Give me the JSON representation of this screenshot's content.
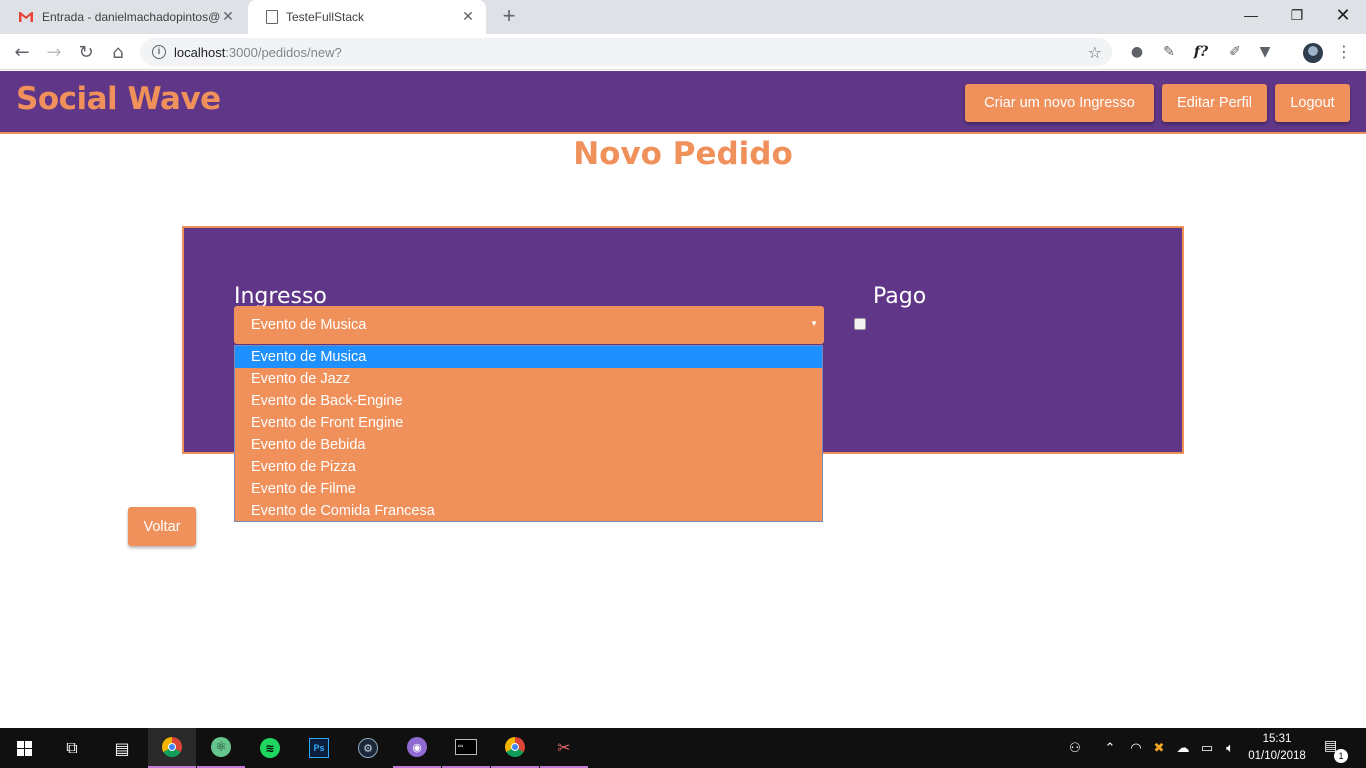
{
  "browser": {
    "tabs": [
      {
        "title": "Entrada - danielmachadopintos@",
        "icon": "gmail-icon",
        "active": false
      },
      {
        "title": "TesteFullStack",
        "icon": "page-icon",
        "active": true
      }
    ],
    "url_host": "localhost",
    "url_path": ":3000/pedidos/new?"
  },
  "navbar": {
    "brand": "Social Wave",
    "buttons": [
      {
        "label": "Criar um novo Ingresso"
      },
      {
        "label": "Editar Perfil"
      },
      {
        "label": "Logout"
      }
    ]
  },
  "page": {
    "title": "Novo Pedido",
    "form": {
      "ingresso_label": "Ingresso",
      "ingresso_selected": "Evento de Musica",
      "pago_label": "Pago",
      "pago_checked": false,
      "options": [
        "Evento de Musica",
        "Evento de Jazz",
        "Evento de Back-Engine",
        "Evento de Front Engine",
        "Evento de Bebida",
        "Evento de Pizza",
        "Evento de Filme",
        "Evento de Comida Francesa"
      ],
      "highlighted_option": "Evento de Musica"
    },
    "back_button": "Voltar"
  },
  "taskbar": {
    "time": "15:31",
    "date": "01/10/2018",
    "notification_count": "1"
  },
  "colors": {
    "primary_purple": "#603689",
    "accent_orange": "#f0905a",
    "option_highlight": "#1e90ff"
  }
}
